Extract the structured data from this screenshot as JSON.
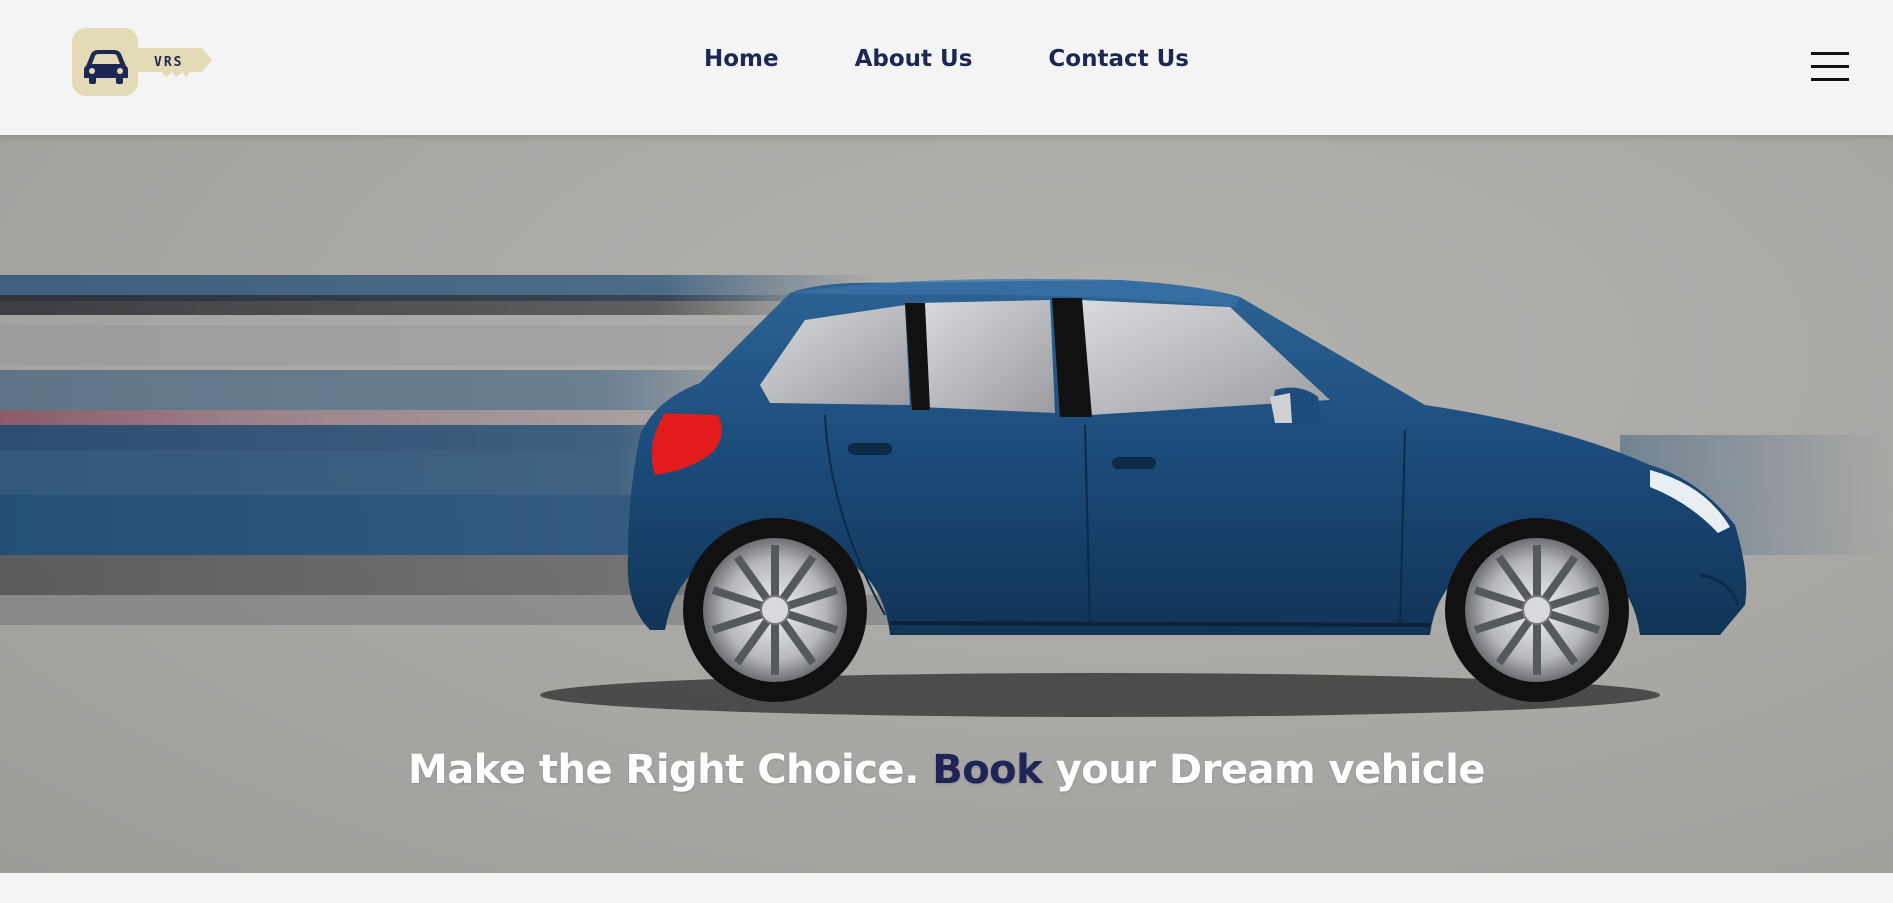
{
  "brand": {
    "logo_text": "VRS",
    "logo_icon": "car-key-icon",
    "logo_color": "#e5dab6",
    "logo_ink": "#1c2754"
  },
  "nav": {
    "links": [
      {
        "label": "Home"
      },
      {
        "label": "About Us"
      },
      {
        "label": "Contact Us"
      }
    ],
    "menu_icon": "hamburger-menu-icon"
  },
  "hero": {
    "image": "blue-hatchback-car-motion-image",
    "tagline_before": "Make the Right Choice.",
    "tagline_accent": "Book",
    "tagline_after": "your Dream vehicle",
    "accent_color": "#1e2358",
    "car_color": "#1f4f7e"
  },
  "colors": {
    "nav_text": "#1c2754",
    "background": "#f4f4f4",
    "hero_gray": "#aaa8a5"
  }
}
